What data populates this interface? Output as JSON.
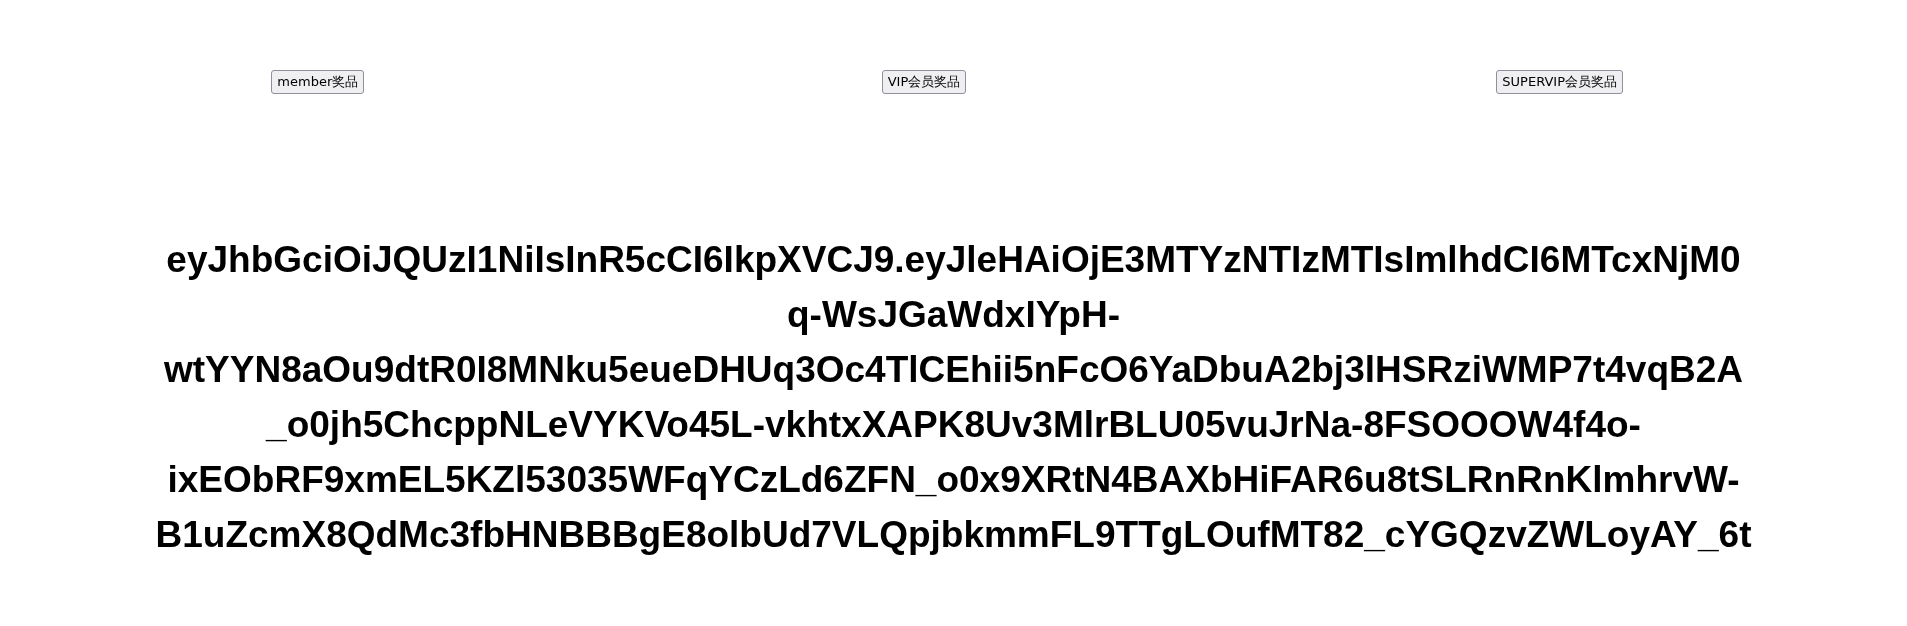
{
  "buttons": [
    {
      "label": "member奖品"
    },
    {
      "label": "VIP会员奖品"
    },
    {
      "label": "SUPERVIP会员奖品"
    }
  ],
  "token_lines": [
    "eyJhbGciOiJQUzI1NiIsInR5cCI6IkpXVCJ9.eyJleHAiOjE3MTYzNTIzMTIsImlhdCI6MTcxNjM0",
    "q-WsJGaWdxIYpH-",
    "wtYYN8aOu9dtR0I8MNku5eueDHUq3Oc4TlCEhii5nFcO6YaDbuA2bj3lHSRziWMP7t4vqB2A",
    "_o0jh5ChcppNLeVYKVo45L-vkhtxXAPK8Uv3MlrBLU05vuJrNa-8FSOOOW4f4o-",
    "ixEObRF9xmEL5KZl53035WFqYCzLd6ZFN_o0x9XRtN4BAXbHiFAR6u8tSLRnRnKlmhrvW-",
    "B1uZcmX8QdMc3fbHNBBBgE8olbUd7VLQpjbkmmFL9TTgLOufMT82_cYGQzvZWLoyAY_6t"
  ]
}
